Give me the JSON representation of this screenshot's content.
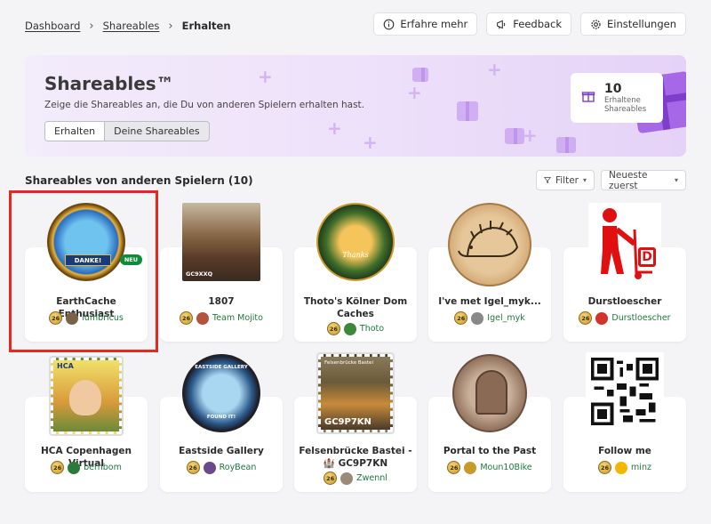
{
  "breadcrumb": {
    "items": [
      "Dashboard",
      "Shareables"
    ],
    "current": "Erhalten",
    "sep": "›"
  },
  "top_actions": {
    "learn_more": "Erfahre mehr",
    "feedback": "Feedback",
    "settings": "Einstellungen"
  },
  "hero": {
    "title": "Shareables™",
    "subtitle": "Zeige die Shareables an, die Du von anderen Spielern erhalten hast.",
    "tabs": [
      {
        "label": "Erhalten",
        "active": true
      },
      {
        "label": "Deine Shareables",
        "active": false
      }
    ],
    "stat": {
      "value": "10",
      "label_line1": "Erhaltene",
      "label_line2": "Shareables"
    }
  },
  "section": {
    "title": "Shareables von anderen Spielern (10)",
    "filter_label": "Filter",
    "sort_label": "Neueste zuerst"
  },
  "cards": [
    {
      "name": "EarthCache Enthusiast",
      "user": "lumbricus",
      "coin": "26",
      "badge": "NEU"
    },
    {
      "name": "1807",
      "user": "Team Mojito",
      "coin": "26"
    },
    {
      "name": "Thoto's Kölner Dom Caches",
      "user": "Thoto",
      "coin": "26"
    },
    {
      "name": "I've met Igel_myk...",
      "user": "Igel_myk",
      "coin": "26"
    },
    {
      "name": "Durstloescher",
      "user": "Durstloescher",
      "coin": "26"
    },
    {
      "name": "HCA Copenhagen Virtual",
      "user": "bernbom",
      "coin": "26"
    },
    {
      "name": "Eastside Gallery",
      "user": "RoyBean",
      "coin": "26"
    },
    {
      "name": "Felsenbrücke Bastei - 🏰 GC9P7KN",
      "user": "Zwennl",
      "coin": "26"
    },
    {
      "name": "Portal to the Past",
      "user": "Moun10Bike",
      "coin": "26"
    },
    {
      "name": "Follow me",
      "user": "minz",
      "coin": "26"
    }
  ],
  "image_text": {
    "danke": "DANKE!",
    "gc_1807": "GC9XXQ",
    "thanks": "Thanks",
    "durst_letter": "D",
    "hca": "HCA",
    "eastside_top": "EASTSIDE GALLERY",
    "eastside_bottom": "FOUND IT!",
    "bastei_top": "Felsenbrücke Bastei",
    "bastei_code": "GC9P7KN"
  },
  "colors": {
    "accent_green": "#1d7a3c",
    "highlight_red": "#e8281e",
    "hero_purple": "#a668e6",
    "badge_green": "#118a3a"
  }
}
